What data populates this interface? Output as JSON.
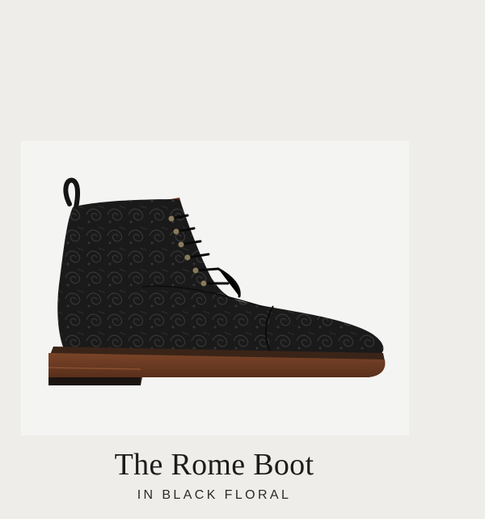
{
  "product": {
    "image_icon": "leather-boot-photo",
    "name": "The Rome Boot",
    "variant": "IN BLACK FLORAL"
  },
  "colors": {
    "page_background": "#eeede9",
    "image_background": "#f4f4f3",
    "boot_leather": "#1b1b1b",
    "sole_brown": "#6b3a22",
    "text": "#1c1c1c"
  }
}
